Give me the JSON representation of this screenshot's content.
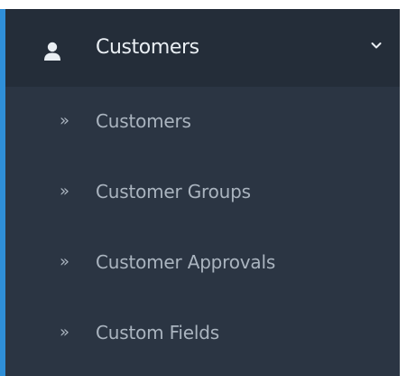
{
  "menu": {
    "header": {
      "label": "Customers",
      "icon": "user-icon",
      "expand_icon": "chevron-down-icon"
    },
    "items": [
      {
        "label": "Customers",
        "icon": "double-chevron-right-icon"
      },
      {
        "label": "Customer Groups",
        "icon": "double-chevron-right-icon"
      },
      {
        "label": "Customer Approvals",
        "icon": "double-chevron-right-icon"
      },
      {
        "label": "Custom Fields",
        "icon": "double-chevron-right-icon"
      }
    ],
    "colors": {
      "accent": "#2f8fd8",
      "header_bg": "#242d39",
      "menu_bg": "#2b3543",
      "header_text": "#e9eef3",
      "item_text": "#aab4bf"
    }
  }
}
